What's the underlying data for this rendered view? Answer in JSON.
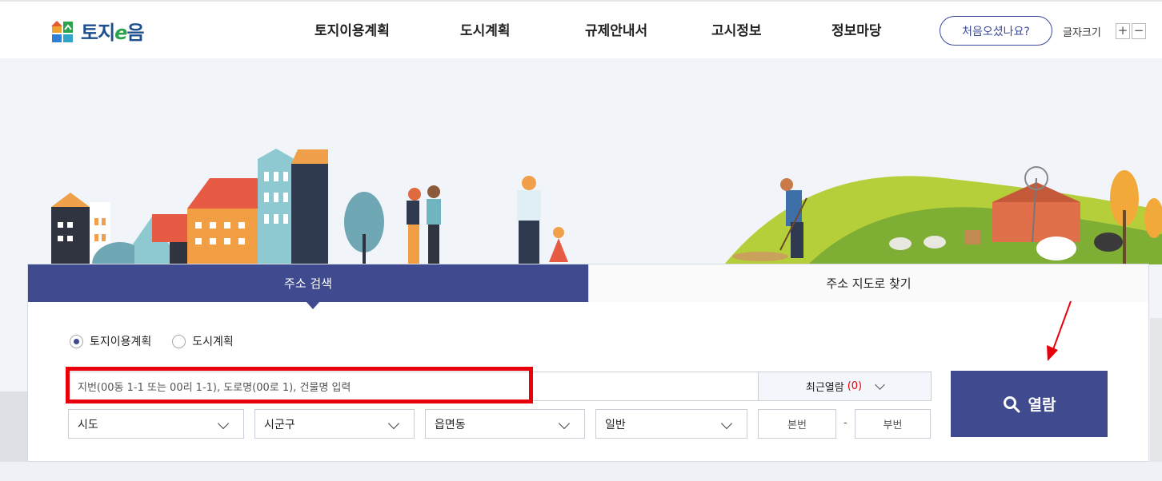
{
  "header": {
    "logo_text_a": "토지",
    "logo_text_e": "e",
    "logo_text_b": "음",
    "nav": [
      {
        "label": "토지이용계획"
      },
      {
        "label": "도시계획"
      },
      {
        "label": "규제안내서"
      },
      {
        "label": "고시정보"
      },
      {
        "label": "정보마당"
      }
    ],
    "first_visit_label": "처음오셨나요?",
    "font_size_label": "글자크기",
    "font_plus": "+",
    "font_minus": "−"
  },
  "search": {
    "tabs": [
      {
        "label": "주소 검색"
      },
      {
        "label": "주소 지도로 찾기"
      }
    ],
    "radios": [
      {
        "label": "토지이용계획"
      },
      {
        "label": "도시계획"
      }
    ],
    "placeholder": "지번(00동 1-1 또는 00리 1-1), 도로명(00로 1), 건물명 입력",
    "recent_label": "최근열람",
    "recent_count": "(0)",
    "selects": [
      {
        "label": "시도"
      },
      {
        "label": "시군구"
      },
      {
        "label": "읍면동"
      },
      {
        "label": "일반"
      }
    ],
    "main_no": "본번",
    "dash": "-",
    "sub_no": "부번",
    "open_label": "열람"
  }
}
